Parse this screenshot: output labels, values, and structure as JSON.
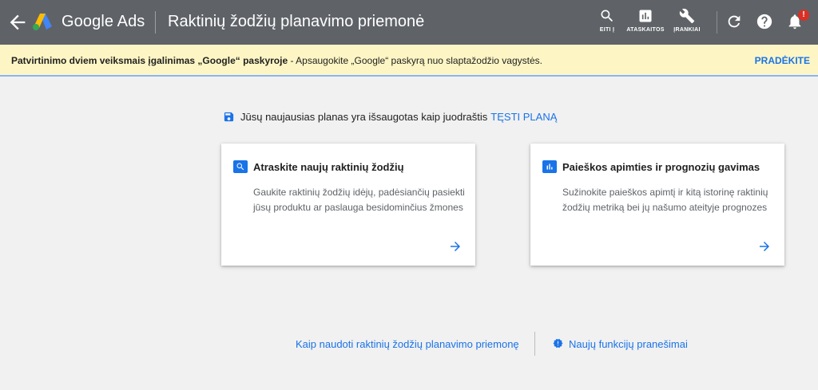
{
  "header": {
    "brand": "Google Ads",
    "title": "Raktinių žodžių planavimo priemonė",
    "nav": [
      {
        "id": "search",
        "label": "EITI Į",
        "icon": "search-icon"
      },
      {
        "id": "reports",
        "label": "ATASKAITOS",
        "icon": "bar-chart-icon"
      },
      {
        "id": "tools",
        "label": "ĮRANKIAI",
        "icon": "wrench-icon"
      }
    ],
    "notification_badge": "!"
  },
  "banner": {
    "bold_text": "Patvirtinimo dviem veiksmais įgalinimas „Google“ paskyroje",
    "text": " - Apsaugokite „Google“ paskyrą nuo slaptažodžio vagystės.",
    "action": "PRADĖKITE"
  },
  "save_notice": {
    "text": "Jūsų naujausias planas yra išsaugotas kaip juodraštis",
    "link": "TĘSTI PLANĄ"
  },
  "cards": [
    {
      "title": "Atraskite naujų raktinių žodžių",
      "description": "Gaukite raktinių žodžių idėjų, padėsiančių pasiekti jūsų produktu ar paslauga besidominčius žmones",
      "icon": "search-icon"
    },
    {
      "title": "Paieškos apimties ir prognozių gavimas",
      "description": "Sužinokite paieškos apimtį ir kitą istorinę raktinių žodžių metriką bei jų našumo ateityje prognozes",
      "icon": "bar-chart-icon"
    }
  ],
  "footer": {
    "how_to_link": "Kaip naudoti raktinių žodžių planavimo priemonę",
    "news_link": "Naujų funkcijų pranešimai"
  },
  "colors": {
    "topbar": "#5f6368",
    "banner": "#fdf6c4",
    "accent": "#1a73e8",
    "background": "#f1f1f1"
  }
}
